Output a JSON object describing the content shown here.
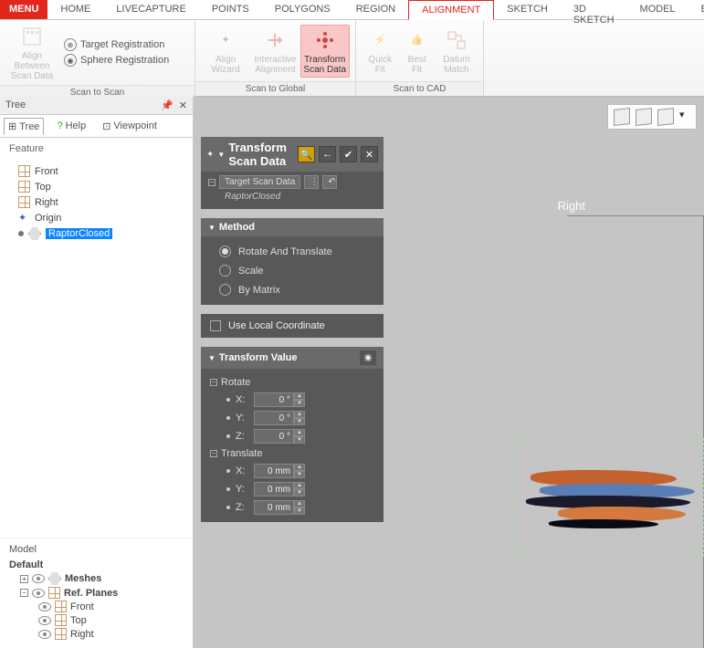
{
  "tabs": {
    "menu": "MENU",
    "items": [
      "HOME",
      "LIVECAPTURE",
      "POINTS",
      "POLYGONS",
      "REGION",
      "ALIGNMENT",
      "SKETCH",
      "3D SKETCH",
      "MODEL",
      "E"
    ],
    "active": "ALIGNMENT"
  },
  "ribbon": {
    "group1": {
      "caption": "Scan to Scan",
      "big": "Align Between\nScan Data",
      "small1": "Target Registration",
      "small2": "Sphere Registration"
    },
    "group2": {
      "caption": "Scan to Global",
      "b1": "Align\nWizard",
      "b2": "Interactive\nAlignment",
      "b3": "Transform\nScan Data"
    },
    "group3": {
      "caption": "Scan to CAD",
      "b1": "Quick\nFit",
      "b2": "Best\nFit",
      "b3": "Datum\nMatch"
    }
  },
  "tree": {
    "panel_title": "Tree",
    "tabs": {
      "tree": "Tree",
      "help": "Help",
      "viewpoint": "Viewpoint"
    },
    "feature_label": "Feature",
    "nodes": {
      "front": "Front",
      "top": "Top",
      "right": "Right",
      "origin": "Origin",
      "raptor": "RaptorClosed"
    },
    "model_label": "Model",
    "model": {
      "default": "Default",
      "meshes": "Meshes",
      "refplanes": "Ref. Planes",
      "front": "Front",
      "top": "Top",
      "right": "Right"
    }
  },
  "canvas": {
    "view_label": "Right"
  },
  "panel": {
    "title": "Transform Scan Data",
    "target_label": "Target Scan Data",
    "target_item": "RaptorClosed",
    "method": {
      "title": "Method",
      "opt1": "Rotate And Translate",
      "opt2": "Scale",
      "opt3": "By Matrix"
    },
    "local_coord": "Use Local Coordinate",
    "tv": {
      "title": "Transform Value",
      "rotate": "Rotate",
      "translate": "Translate",
      "x": "X:",
      "y": "Y:",
      "z": "Z:",
      "rx": "0 °",
      "ry": "0 °",
      "rz": "0 °",
      "tx": "0 mm",
      "ty": "0 mm",
      "tz": "0 mm"
    }
  }
}
